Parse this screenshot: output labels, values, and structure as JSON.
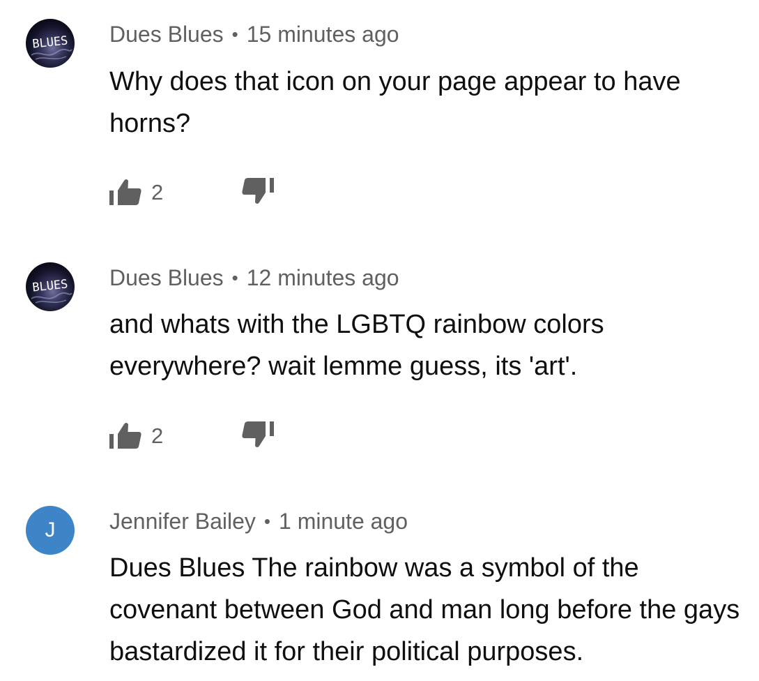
{
  "comments": [
    {
      "author": "Dues Blues",
      "time": "15 minutes ago",
      "text": "Why does that icon on your page appear to have horns?",
      "avatar_text": "BLUES",
      "likes": "2"
    },
    {
      "author": "Dues Blues",
      "time": "12 minutes ago",
      "text": "and whats with the LGBTQ rainbow colors everywhere? wait lemme guess, its 'art'.",
      "avatar_text": "BLUES",
      "likes": "2"
    },
    {
      "author": "Jennifer Bailey",
      "time": "1 minute ago",
      "text": "Dues Blues The rainbow was a symbol of the covenant between God and man long before the gays bastardized it for their political purposes.",
      "avatar_letter": "J"
    }
  ],
  "separator": "•",
  "icons": {
    "like": "thumb-up-icon",
    "dislike": "thumb-down-icon"
  },
  "colors": {
    "avatar_letter_bg": "#3d85c6",
    "meta_text": "#606060",
    "body_text": "#0f0f0f"
  }
}
